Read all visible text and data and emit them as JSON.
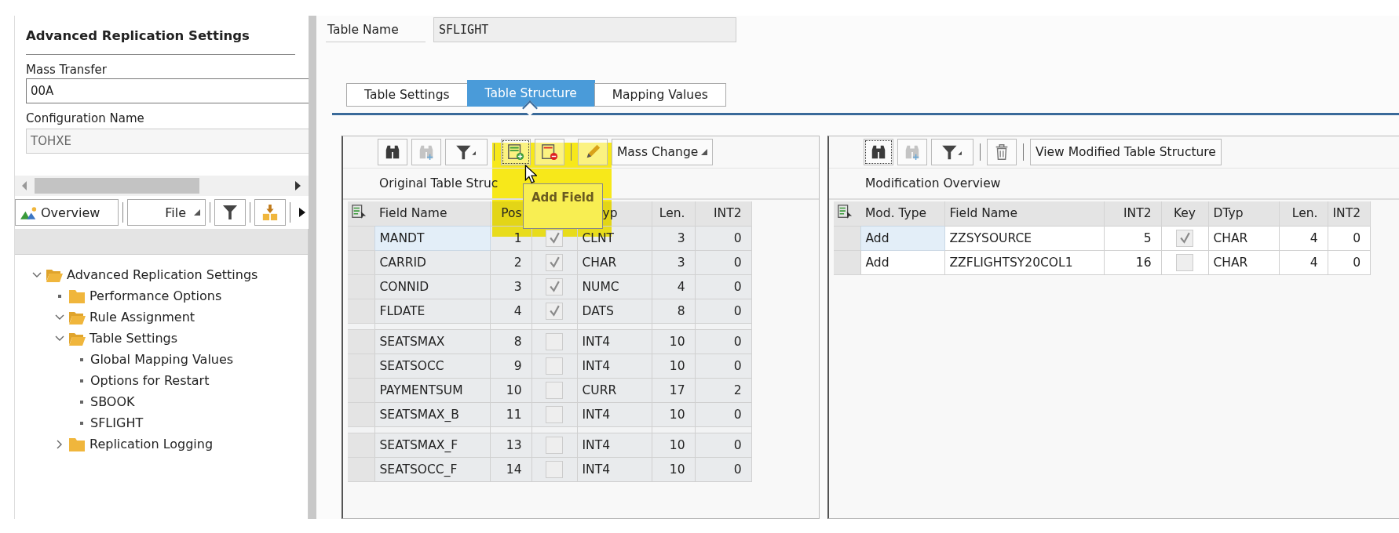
{
  "sidebar": {
    "title": "Advanced Replication Settings",
    "fields": [
      {
        "label": "Mass Transfer",
        "value": "00A",
        "disabled": false
      },
      {
        "label": "Configuration Name",
        "value": "TOHXE",
        "disabled": true
      }
    ],
    "toolbar": {
      "overview": "Overview",
      "file": "File"
    },
    "tree": [
      {
        "label": "Advanced Replication Settings",
        "kind": "folder",
        "expanded": true,
        "children": [
          {
            "label": "Performance Options",
            "kind": "folder"
          },
          {
            "label": "Rule Assignment",
            "kind": "folder",
            "expanded": true
          },
          {
            "label": "Table Settings",
            "kind": "folder",
            "expanded": true,
            "children": [
              {
                "label": "Global Mapping Values",
                "kind": "item"
              },
              {
                "label": "Options for Restart",
                "kind": "item"
              },
              {
                "label": "SBOOK",
                "kind": "item"
              },
              {
                "label": "SFLIGHT",
                "kind": "item"
              }
            ]
          },
          {
            "label": "Replication Logging",
            "kind": "folder",
            "expanded": false
          }
        ]
      }
    ]
  },
  "table_name": {
    "label": "Table Name",
    "value": "SFLIGHT"
  },
  "tabs": [
    {
      "label": "Table Settings",
      "selected": false
    },
    {
      "label": "Table Structure",
      "selected": true
    },
    {
      "label": "Mapping Values",
      "selected": false
    }
  ],
  "original_table": {
    "mass_change": "Mass Change",
    "title": "Original Table Struc",
    "columns": [
      {
        "label": "Field Name",
        "kind": "text"
      },
      {
        "label": "Pos",
        "kind": "number"
      },
      {
        "kind": "check"
      },
      {
        "label": "yp",
        "kind": "text"
      },
      {
        "label": "Len.",
        "kind": "number"
      },
      {
        "label": "INT2",
        "kind": "number"
      }
    ],
    "rows": [
      {
        "values": [
          "MANDT",
          "1",
          true,
          "CLNT",
          "3",
          "0"
        ],
        "selected": true,
        "gap_before": false
      },
      {
        "values": [
          "CARRID",
          "2",
          true,
          "CHAR",
          "3",
          "0"
        ],
        "selected": false,
        "gap_before": false
      },
      {
        "values": [
          "CONNID",
          "3",
          true,
          "NUMC",
          "4",
          "0"
        ],
        "selected": false,
        "gap_before": false
      },
      {
        "values": [
          "FLDATE",
          "4",
          true,
          "DATS",
          "8",
          "0"
        ],
        "selected": false,
        "gap_before": false
      },
      {
        "values": [
          "SEATSMAX",
          "8",
          false,
          "INT4",
          "10",
          "0"
        ],
        "selected": false,
        "gap_before": true
      },
      {
        "values": [
          "SEATSOCC",
          "9",
          false,
          "INT4",
          "10",
          "0"
        ],
        "selected": false,
        "gap_before": false
      },
      {
        "values": [
          "PAYMENTSUM",
          "10",
          false,
          "CURR",
          "17",
          "2"
        ],
        "selected": false,
        "gap_before": false
      },
      {
        "values": [
          "SEATSMAX_B",
          "11",
          false,
          "INT4",
          "10",
          "0"
        ],
        "selected": false,
        "gap_before": false
      },
      {
        "values": [
          "SEATSMAX_F",
          "13",
          false,
          "INT4",
          "10",
          "0"
        ],
        "selected": false,
        "gap_before": true
      },
      {
        "values": [
          "SEATSOCC_F",
          "14",
          false,
          "INT4",
          "10",
          "0"
        ],
        "selected": false,
        "gap_before": false
      }
    ]
  },
  "tooltip": "Add Field",
  "modification_table": {
    "view_button": "View Modified Table Structure",
    "title": "Modification Overview",
    "columns": [
      {
        "label": "Mod. Type",
        "kind": "text"
      },
      {
        "label": "Field Name",
        "kind": "text"
      },
      {
        "label": "INT2",
        "kind": "number"
      },
      {
        "label": "Key",
        "kind": "check"
      },
      {
        "label": "DTyp",
        "kind": "text"
      },
      {
        "label": "Len.",
        "kind": "number"
      },
      {
        "label": "INT2",
        "kind": "number"
      }
    ],
    "rows": [
      {
        "values": [
          "Add",
          "ZZSYSOURCE",
          "5",
          true,
          "CHAR",
          "4",
          "0"
        ],
        "selected": true
      },
      {
        "values": [
          "Add",
          "ZZFLIGHTSY20COL1",
          "16",
          false,
          "CHAR",
          "4",
          "0"
        ],
        "selected": false
      }
    ]
  }
}
